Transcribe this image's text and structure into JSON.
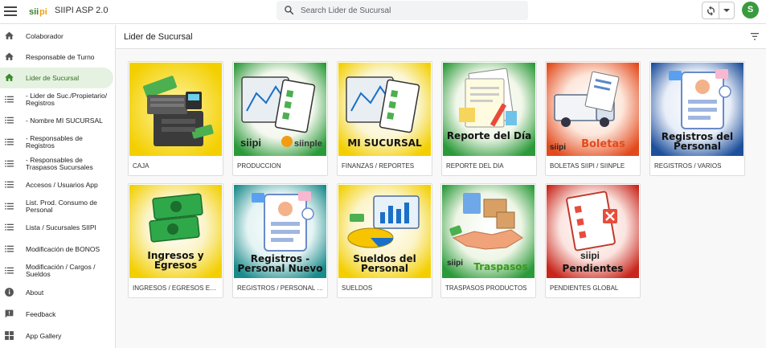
{
  "app": {
    "logo_text": "SIIPI",
    "title": "SIIPI ASP 2.0"
  },
  "search": {
    "placeholder": "Search Lider de Sucursal"
  },
  "user": {
    "avatar_letter": "S"
  },
  "sidebar": {
    "items": [
      {
        "label": "Colaborador",
        "icon": "home-icon"
      },
      {
        "label": "Responsable de Turno",
        "icon": "home-icon"
      },
      {
        "label": "Lider de Sucursal",
        "icon": "home-icon",
        "active": true
      },
      {
        "label": "- Lider de Suc./Propietario/ Registros",
        "icon": "list-icon"
      },
      {
        "label": "- Nombre MI SUCURSAL",
        "icon": "list-icon"
      },
      {
        "label": "- Responsables de Registros",
        "icon": "list-icon"
      },
      {
        "label": "- Responsables de Traspasos Sucursales",
        "icon": "list-icon"
      },
      {
        "label": "Accesos / Usuarios App",
        "icon": "list-icon"
      },
      {
        "label": "List. Prod. Consumo de Personal",
        "icon": "list-icon"
      },
      {
        "label": "Lista / Sucursales SIIPI",
        "icon": "list-icon"
      },
      {
        "label": "Modificación de BONOS",
        "icon": "list-icon"
      },
      {
        "label": "Modificación / Cargos / Sueldos",
        "icon": "list-icon"
      },
      {
        "label": "About",
        "icon": "info-icon"
      },
      {
        "label": "Feedback",
        "icon": "feedback-icon"
      },
      {
        "label": "App Gallery",
        "icon": "grid-icon"
      }
    ]
  },
  "main": {
    "title": "Lider de Sucursal",
    "cards": [
      {
        "caption": "CAJA",
        "image_text": "",
        "image_brand": ""
      },
      {
        "caption": "PRODUCCION",
        "image_text": "",
        "image_brand": "siipi siinple"
      },
      {
        "caption": "FINANZAS / REPORTES",
        "image_text": "MI SUCURSAL",
        "image_brand": ""
      },
      {
        "caption": "REPORTE DEL DIA",
        "image_text": "Reporte del Día",
        "image_brand": ""
      },
      {
        "caption": "BOLETAS SIIPI / SIINPLE",
        "image_text": "Boletas",
        "image_brand": "siipi siinple"
      },
      {
        "caption": "REGISTROS / VARIOS",
        "image_text": "Registros del Personal",
        "image_brand": ""
      },
      {
        "caption": "INGRESOS / EGRESOS EXTRAS",
        "image_text": "Ingresos y Egresos",
        "image_brand": ""
      },
      {
        "caption": "REGISTROS / PERSONAL NUEVO",
        "image_text": "Registros - Personal Nuevo",
        "image_brand": ""
      },
      {
        "caption": "SUELDOS",
        "image_text": "Sueldos del Personal",
        "image_brand": ""
      },
      {
        "caption": "TRASPASOS PRODUCTOS",
        "image_text": "Traspasos",
        "image_brand": "siipi siinple"
      },
      {
        "caption": "PENDIENTES GLOBAL",
        "image_text": "Pendientes",
        "image_brand": "siipi"
      }
    ]
  },
  "colors": {
    "accent": "#3a9a3e",
    "active_bg": "#e6f2e1",
    "yellow": "#f5d000",
    "green": "#2e9a3a",
    "red": "#e24a1c",
    "blue": "#1d4f9c",
    "teal": "#1a8a8a"
  }
}
